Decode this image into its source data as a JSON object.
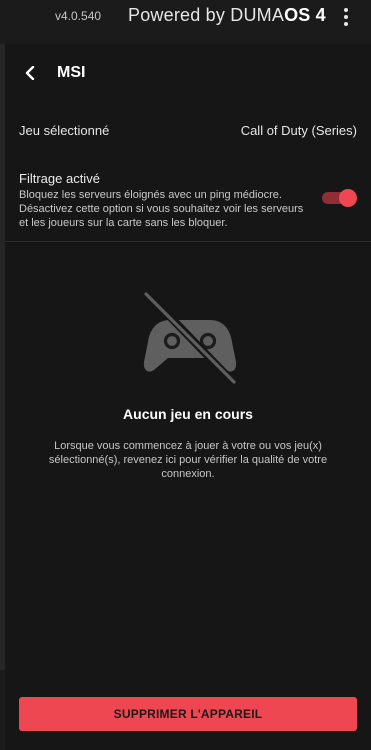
{
  "topbar": {
    "version": "v4.0.540",
    "powered_prefix": "Powered by DUMA",
    "powered_brand": "OS 4",
    "menu_icon": "kebab-menu-icon"
  },
  "header": {
    "back_icon": "chevron-left-icon",
    "title": "MSI"
  },
  "selected_game": {
    "label": "Jeu sélectionné",
    "value": "Call of Duty (Series)"
  },
  "filtering": {
    "title": "Filtrage activé",
    "description": "Bloquez les serveurs éloignés avec un ping médiocre. Désactivez cette option si vous souhaitez voir les serveurs et les joueurs sur la carte sans les bloquer.",
    "enabled": true
  },
  "empty_state": {
    "icon": "gamepad-off-icon",
    "title": "Aucun jeu en cours",
    "description": "Lorsque vous commencez à jouer à votre ou vos jeu(x) sélectionné(s), revenez ici pour vérifier la qualité de votre connexion."
  },
  "actions": {
    "delete_label": "SUPPRIMER L'APPAREIL"
  },
  "colors": {
    "accent": "#ef4752",
    "background": "#161616"
  }
}
